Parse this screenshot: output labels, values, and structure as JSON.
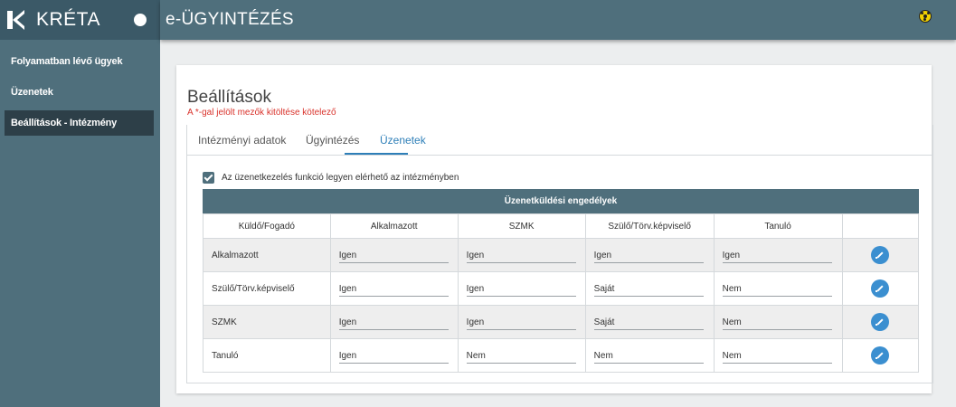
{
  "app": {
    "name": "KRÉTA",
    "page_title": "e-ÜGYINTÉZÉS"
  },
  "sidebar": {
    "items": [
      {
        "label": "Folyamatban lévő ügyek",
        "active": false
      },
      {
        "label": "Üzenetek",
        "active": false
      },
      {
        "label": "Beállítások - Intézmény",
        "active": true
      }
    ]
  },
  "card": {
    "title": "Beállítások",
    "required_note": "A *-gal jelölt mezők kitöltése kötelező"
  },
  "tabs": [
    "Intézményi adatok",
    "Ügyintézés",
    "Üzenetek"
  ],
  "active_tab": "Üzenetek",
  "checkbox": {
    "label": "Az üzenetkezelés funkció legyen elérhető az intézményben",
    "checked": true
  },
  "grid": {
    "title": "Üzenetküldési engedélyek",
    "headers": [
      "Küldő/Fogadó",
      "Alkalmazott",
      "SZMK",
      "Szülő/Törv.képviselő",
      "Tanuló",
      ""
    ],
    "rows": [
      {
        "label": "Alkalmazott",
        "values": [
          "Igen",
          "Igen",
          "Igen",
          "Igen"
        ]
      },
      {
        "label": "Szülő/Törv.képviselő",
        "values": [
          "Igen",
          "Igen",
          "Saját",
          "Nem"
        ]
      },
      {
        "label": "SZMK",
        "values": [
          "Igen",
          "Igen",
          "Saját",
          "Nem"
        ]
      },
      {
        "label": "Tanuló",
        "values": [
          "Igen",
          "Nem",
          "Nem",
          "Nem"
        ]
      }
    ]
  },
  "colors": {
    "primary": "#4f6f7c",
    "accent": "#2e7fb8",
    "required": "#d9322b",
    "edit_button": "#3b8fd0"
  },
  "icons": {
    "logo": "kreta-logo-icon",
    "header_right": "hazard-icon",
    "row_action": "pencil-icon"
  }
}
